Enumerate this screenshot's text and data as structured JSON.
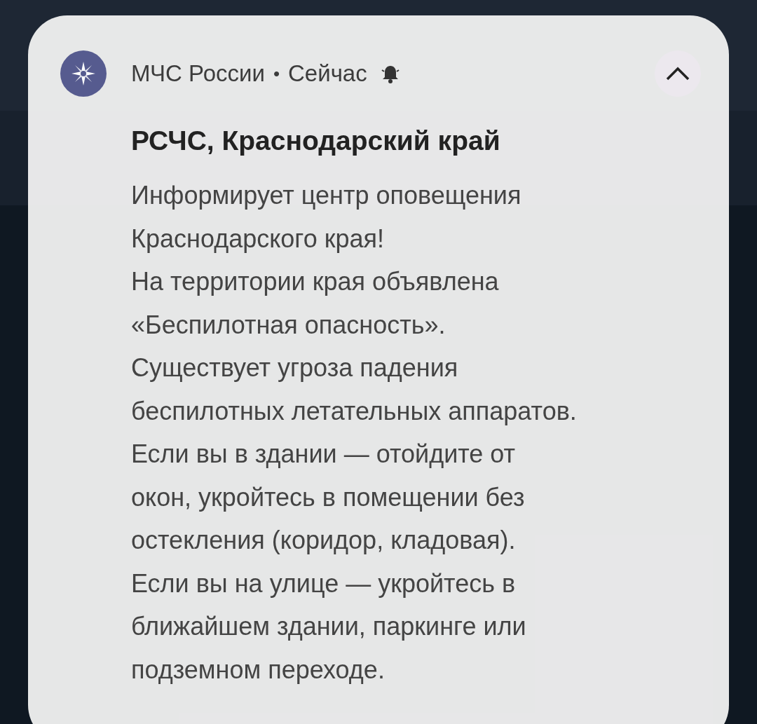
{
  "notification": {
    "app_name": "МЧС России",
    "separator": "•",
    "time": "Сейчас",
    "alerting": true,
    "expanded": true,
    "title": "РСЧС, Краснодарский край",
    "body": "Информирует центр оповещения\nКраснодарского края!\nНа территории края объявлена\n«Беспилотная опасность».\nСуществует угроза падения\nбеспилотных летательных аппаратов.\nЕсли вы в здании — отойдите от\nокон, укройтесь в помещении без\nостекления (коридор, кладовая).\nЕсли вы на улице — укройтесь в\nближайшем здании, паркинге или\nподземном переходе."
  }
}
